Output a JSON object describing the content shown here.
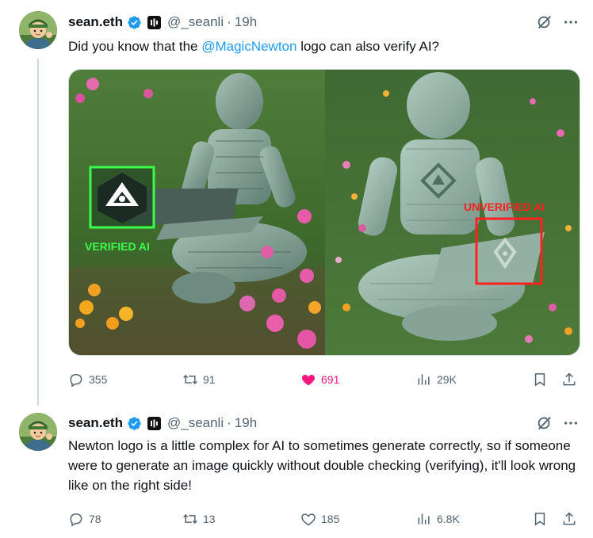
{
  "tweets": [
    {
      "display_name": "sean.eth",
      "handle": "@_seanli",
      "separator": "·",
      "time": "19h",
      "text_before": "Did you know that the ",
      "mention": "@MagicNewton",
      "text_after": " logo can also verify AI?",
      "image_labels": {
        "left": "VERIFIED AI",
        "right": "UNVERIFIED AI"
      },
      "stats": {
        "replies": "355",
        "reposts": "91",
        "likes": "691",
        "liked": true,
        "views": "29K"
      }
    },
    {
      "display_name": "sean.eth",
      "handle": "@_seanli",
      "separator": "·",
      "time": "19h",
      "text": "Newton logo is a little complex for AI to sometimes generate correctly, so if someone were to generate an image quickly without double checking (verifying), it'll look wrong like on the right side!",
      "stats": {
        "replies": "78",
        "reposts": "13",
        "likes": "185",
        "liked": false,
        "views": "6.8K"
      }
    }
  ],
  "colors": {
    "link": "#1d9bf0",
    "secondary_text": "#536471",
    "like_active": "#f91880",
    "verified": "#1d9bf0",
    "verified_label": "#39ff4a",
    "unverified_label": "#ff2020"
  },
  "icons": [
    "verified-badge-icon",
    "grok-icon",
    "more-icon",
    "reply-icon",
    "repost-icon",
    "like-icon",
    "views-icon",
    "bookmark-icon",
    "share-icon"
  ]
}
